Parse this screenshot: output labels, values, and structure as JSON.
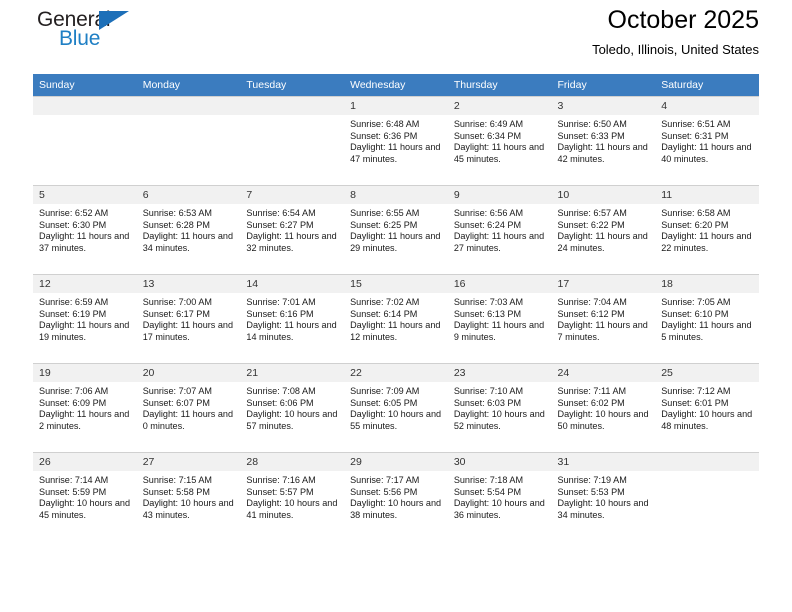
{
  "logo": {
    "word_top": "General",
    "word_bottom": "Blue",
    "triangle_icon": "triangle-icon",
    "accent_color": "#1d6fb8"
  },
  "header": {
    "title": "October 2025",
    "subtitle": "Toledo, Illinois, United States"
  },
  "calendar": {
    "header_color": "#3b7cbf",
    "weekday_headers": [
      "Sunday",
      "Monday",
      "Tuesday",
      "Wednesday",
      "Thursday",
      "Friday",
      "Saturday"
    ],
    "weeks": [
      [
        {
          "empty": true
        },
        {
          "empty": true
        },
        {
          "empty": true
        },
        {
          "day": "1",
          "sunrise": "Sunrise: 6:48 AM",
          "sunset": "Sunset: 6:36 PM",
          "daylight": "Daylight: 11 hours and 47 minutes."
        },
        {
          "day": "2",
          "sunrise": "Sunrise: 6:49 AM",
          "sunset": "Sunset: 6:34 PM",
          "daylight": "Daylight: 11 hours and 45 minutes."
        },
        {
          "day": "3",
          "sunrise": "Sunrise: 6:50 AM",
          "sunset": "Sunset: 6:33 PM",
          "daylight": "Daylight: 11 hours and 42 minutes."
        },
        {
          "day": "4",
          "sunrise": "Sunrise: 6:51 AM",
          "sunset": "Sunset: 6:31 PM",
          "daylight": "Daylight: 11 hours and 40 minutes."
        }
      ],
      [
        {
          "day": "5",
          "sunrise": "Sunrise: 6:52 AM",
          "sunset": "Sunset: 6:30 PM",
          "daylight": "Daylight: 11 hours and 37 minutes."
        },
        {
          "day": "6",
          "sunrise": "Sunrise: 6:53 AM",
          "sunset": "Sunset: 6:28 PM",
          "daylight": "Daylight: 11 hours and 34 minutes."
        },
        {
          "day": "7",
          "sunrise": "Sunrise: 6:54 AM",
          "sunset": "Sunset: 6:27 PM",
          "daylight": "Daylight: 11 hours and 32 minutes."
        },
        {
          "day": "8",
          "sunrise": "Sunrise: 6:55 AM",
          "sunset": "Sunset: 6:25 PM",
          "daylight": "Daylight: 11 hours and 29 minutes."
        },
        {
          "day": "9",
          "sunrise": "Sunrise: 6:56 AM",
          "sunset": "Sunset: 6:24 PM",
          "daylight": "Daylight: 11 hours and 27 minutes."
        },
        {
          "day": "10",
          "sunrise": "Sunrise: 6:57 AM",
          "sunset": "Sunset: 6:22 PM",
          "daylight": "Daylight: 11 hours and 24 minutes."
        },
        {
          "day": "11",
          "sunrise": "Sunrise: 6:58 AM",
          "sunset": "Sunset: 6:20 PM",
          "daylight": "Daylight: 11 hours and 22 minutes."
        }
      ],
      [
        {
          "day": "12",
          "sunrise": "Sunrise: 6:59 AM",
          "sunset": "Sunset: 6:19 PM",
          "daylight": "Daylight: 11 hours and 19 minutes."
        },
        {
          "day": "13",
          "sunrise": "Sunrise: 7:00 AM",
          "sunset": "Sunset: 6:17 PM",
          "daylight": "Daylight: 11 hours and 17 minutes."
        },
        {
          "day": "14",
          "sunrise": "Sunrise: 7:01 AM",
          "sunset": "Sunset: 6:16 PM",
          "daylight": "Daylight: 11 hours and 14 minutes."
        },
        {
          "day": "15",
          "sunrise": "Sunrise: 7:02 AM",
          "sunset": "Sunset: 6:14 PM",
          "daylight": "Daylight: 11 hours and 12 minutes."
        },
        {
          "day": "16",
          "sunrise": "Sunrise: 7:03 AM",
          "sunset": "Sunset: 6:13 PM",
          "daylight": "Daylight: 11 hours and 9 minutes."
        },
        {
          "day": "17",
          "sunrise": "Sunrise: 7:04 AM",
          "sunset": "Sunset: 6:12 PM",
          "daylight": "Daylight: 11 hours and 7 minutes."
        },
        {
          "day": "18",
          "sunrise": "Sunrise: 7:05 AM",
          "sunset": "Sunset: 6:10 PM",
          "daylight": "Daylight: 11 hours and 5 minutes."
        }
      ],
      [
        {
          "day": "19",
          "sunrise": "Sunrise: 7:06 AM",
          "sunset": "Sunset: 6:09 PM",
          "daylight": "Daylight: 11 hours and 2 minutes."
        },
        {
          "day": "20",
          "sunrise": "Sunrise: 7:07 AM",
          "sunset": "Sunset: 6:07 PM",
          "daylight": "Daylight: 11 hours and 0 minutes."
        },
        {
          "day": "21",
          "sunrise": "Sunrise: 7:08 AM",
          "sunset": "Sunset: 6:06 PM",
          "daylight": "Daylight: 10 hours and 57 minutes."
        },
        {
          "day": "22",
          "sunrise": "Sunrise: 7:09 AM",
          "sunset": "Sunset: 6:05 PM",
          "daylight": "Daylight: 10 hours and 55 minutes."
        },
        {
          "day": "23",
          "sunrise": "Sunrise: 7:10 AM",
          "sunset": "Sunset: 6:03 PM",
          "daylight": "Daylight: 10 hours and 52 minutes."
        },
        {
          "day": "24",
          "sunrise": "Sunrise: 7:11 AM",
          "sunset": "Sunset: 6:02 PM",
          "daylight": "Daylight: 10 hours and 50 minutes."
        },
        {
          "day": "25",
          "sunrise": "Sunrise: 7:12 AM",
          "sunset": "Sunset: 6:01 PM",
          "daylight": "Daylight: 10 hours and 48 minutes."
        }
      ],
      [
        {
          "day": "26",
          "sunrise": "Sunrise: 7:14 AM",
          "sunset": "Sunset: 5:59 PM",
          "daylight": "Daylight: 10 hours and 45 minutes."
        },
        {
          "day": "27",
          "sunrise": "Sunrise: 7:15 AM",
          "sunset": "Sunset: 5:58 PM",
          "daylight": "Daylight: 10 hours and 43 minutes."
        },
        {
          "day": "28",
          "sunrise": "Sunrise: 7:16 AM",
          "sunset": "Sunset: 5:57 PM",
          "daylight": "Daylight: 10 hours and 41 minutes."
        },
        {
          "day": "29",
          "sunrise": "Sunrise: 7:17 AM",
          "sunset": "Sunset: 5:56 PM",
          "daylight": "Daylight: 10 hours and 38 minutes."
        },
        {
          "day": "30",
          "sunrise": "Sunrise: 7:18 AM",
          "sunset": "Sunset: 5:54 PM",
          "daylight": "Daylight: 10 hours and 36 minutes."
        },
        {
          "day": "31",
          "sunrise": "Sunrise: 7:19 AM",
          "sunset": "Sunset: 5:53 PM",
          "daylight": "Daylight: 10 hours and 34 minutes."
        },
        {
          "empty": true
        }
      ]
    ]
  }
}
